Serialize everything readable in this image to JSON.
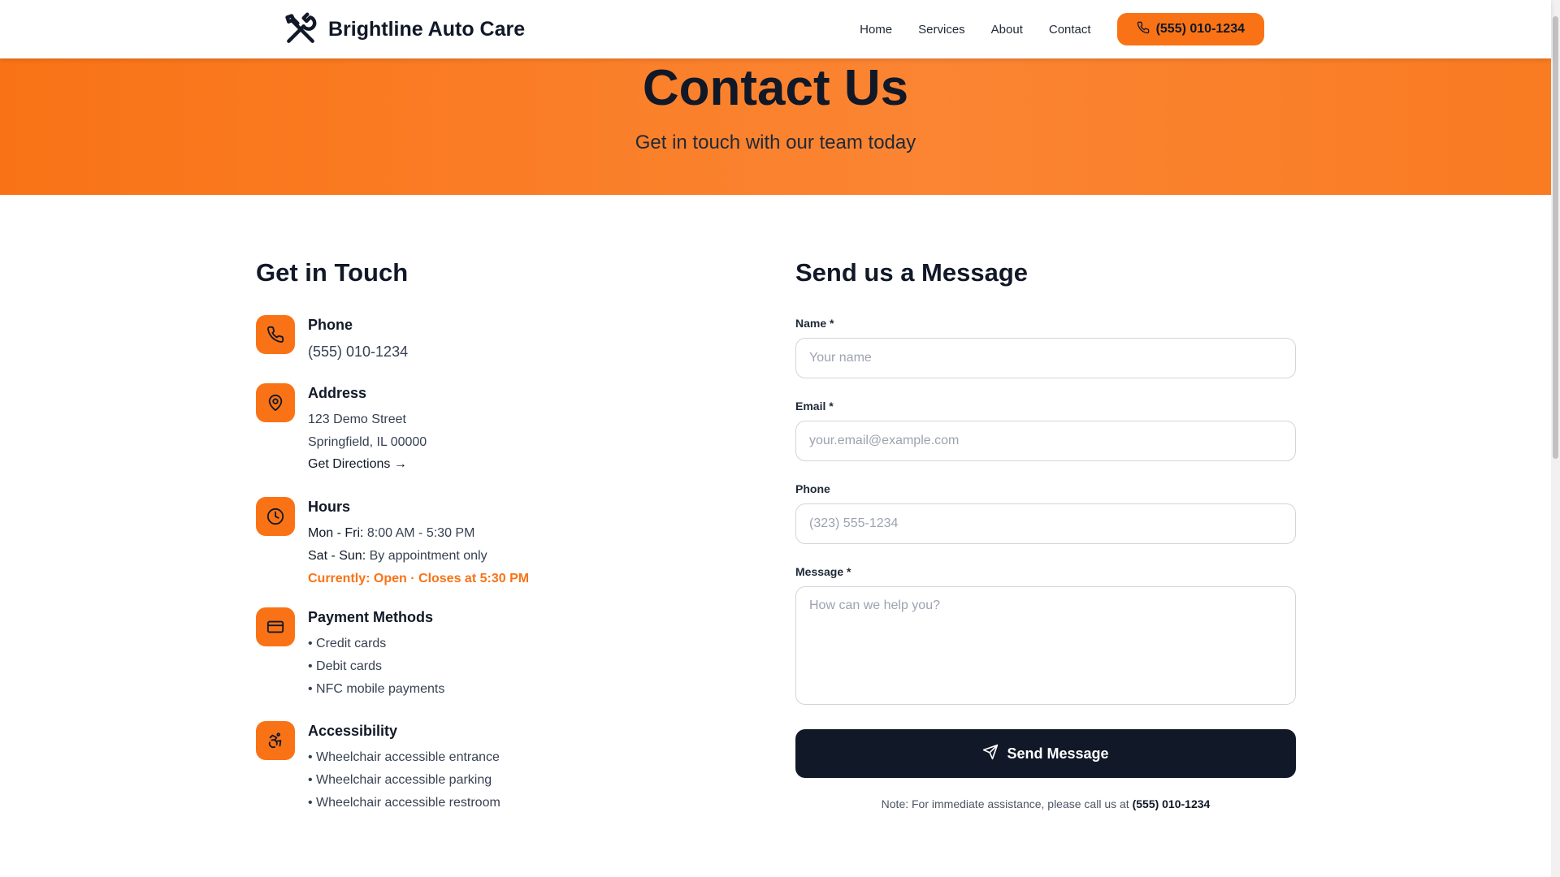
{
  "header": {
    "brand_name": "Brightline Auto Care",
    "brand_icon": "tools-icon",
    "nav": [
      "Home",
      "Services",
      "About",
      "Contact"
    ],
    "call_label": "(555) 010-1234"
  },
  "hero": {
    "title": "Contact Us",
    "subtitle": "Get in touch with our team today"
  },
  "contact": {
    "title": "Get in Touch",
    "phone": {
      "title": "Phone",
      "value": "(555) 010-1234"
    },
    "address": {
      "title": "Address",
      "line1": "123 Demo Street",
      "line2": "Springfield, IL 00000",
      "directions": "Get Directions →"
    },
    "hours": {
      "title": "Hours",
      "weekday_label": "Mon - Fri:",
      "weekday_value": " 8:00 AM - 5:30 PM",
      "weekend_label": "Sat - Sun:",
      "weekend_value": " By appointment only",
      "status": "Currently: Open · Closes at 5:30 PM"
    },
    "payment": {
      "title": "Payment Methods",
      "items": [
        "• Credit cards",
        "• Debit cards",
        "• NFC mobile payments"
      ]
    },
    "accessibility": {
      "title": "Accessibility",
      "items": [
        "• Wheelchair accessible entrance",
        "• Wheelchair accessible parking",
        "• Wheelchair accessible restroom"
      ]
    }
  },
  "form": {
    "title": "Send us a Message",
    "name_label": "Name *",
    "name_placeholder": "Your name",
    "email_label": "Email *",
    "email_placeholder": "your.email@example.com",
    "phone_label": "Phone",
    "phone_placeholder": "(323) 555-1234",
    "message_label": "Message *",
    "message_placeholder": "How can we help you?",
    "submit_label": "Send Message",
    "note_text": "Note: For immediate assistance, please call us at ",
    "note_phone": "(555) 010-1234"
  },
  "colors": {
    "accent": "#f97316",
    "dark": "#111827"
  }
}
